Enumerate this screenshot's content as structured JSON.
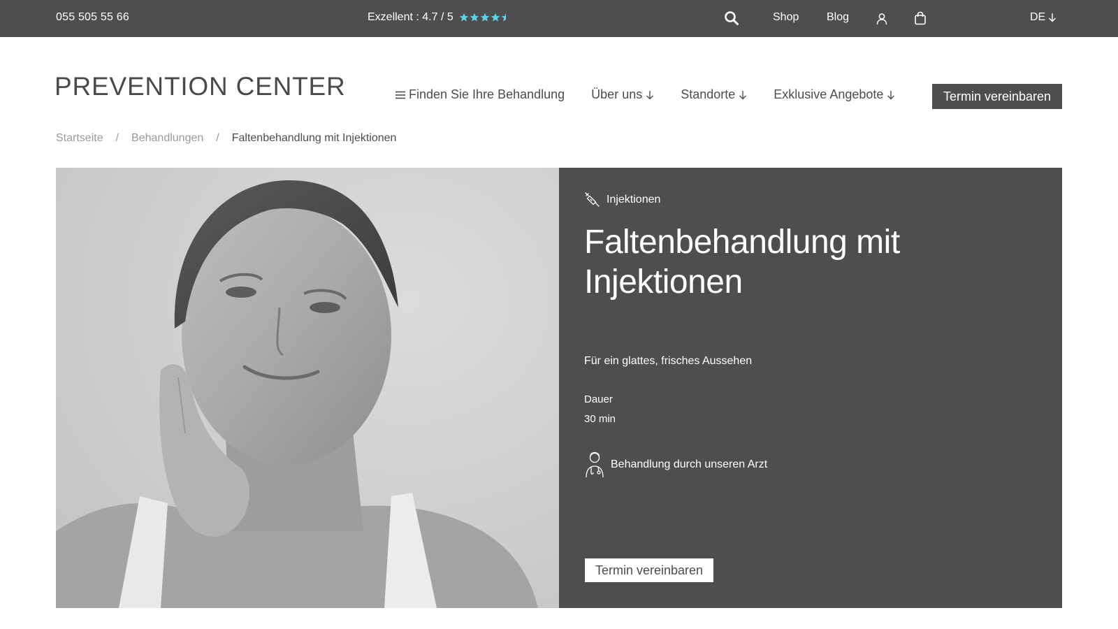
{
  "topbar": {
    "phone": "055 505 55 66",
    "rating_text": "Exzellent : 4.7 / 5",
    "rating_value": 4.7,
    "rating_max": 5,
    "star_color": "#5bd3e8",
    "search_icon": "search-icon",
    "shop_label": "Shop",
    "blog_label": "Blog",
    "user_icon": "user-icon",
    "cart_icon": "shopping-bag-icon",
    "language": "DE"
  },
  "header": {
    "logo": "PREVENTION CENTER",
    "nav": {
      "find": "Finden Sie Ihre Behandlung",
      "about": "Über uns",
      "locations": "Standorte",
      "offers": "Exklusive Angebote"
    },
    "cta": "Termin vereinbaren"
  },
  "breadcrumb": {
    "home": "Startseite",
    "treatments": "Behandlungen",
    "current": "Faltenbehandlung mit Injektionen",
    "separator": "/"
  },
  "hero": {
    "category": "Injektionen",
    "title": "Faltenbehandlung mit Injektionen",
    "subtitle": "Für ein glattes, frisches Aussehen",
    "duration_label": "Dauer",
    "duration_value": "30 min",
    "doctor_text": "Behandlung durch unseren Arzt",
    "cta": "Termin vereinbaren",
    "panel_color": "#4e4e4e"
  },
  "colors": {
    "topbar_bg": "#4e4e4e",
    "text": "#4d4d4d",
    "muted": "#9a9a9a"
  }
}
